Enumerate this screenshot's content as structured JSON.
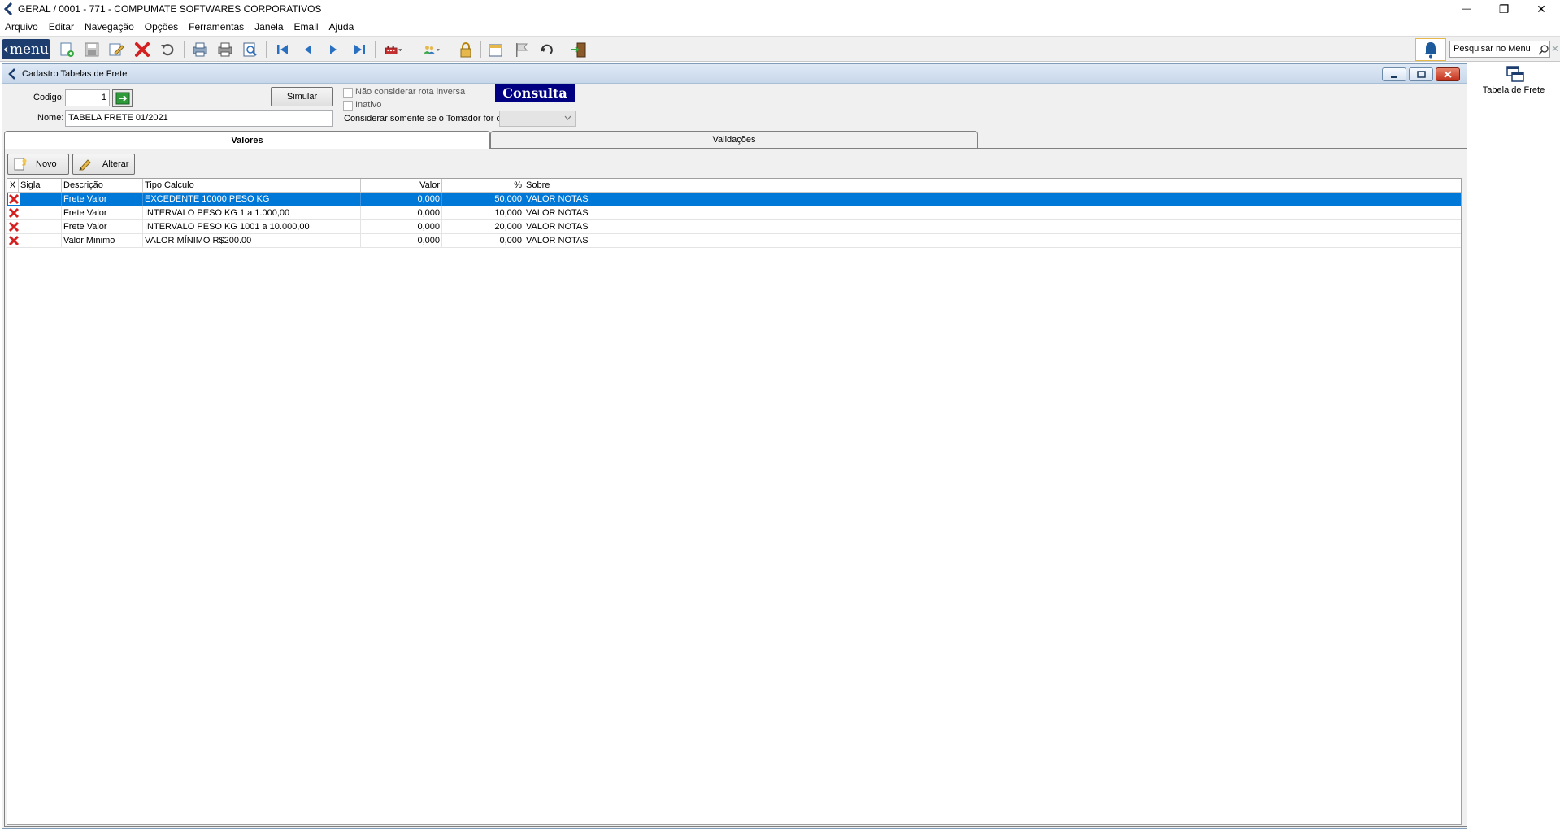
{
  "window": {
    "title": "GERAL / 0001 - 771 - COMPUMATE SOFTWARES CORPORATIVOS",
    "minimize_glyph": "—",
    "restore_glyph": "❐",
    "close_glyph": "✕"
  },
  "menubar": {
    "items": [
      "Arquivo",
      "Editar",
      "Navegação",
      "Opções",
      "Ferramentas",
      "Janela",
      "Email",
      "Ajuda"
    ]
  },
  "toolbar": {
    "menu_label": "menu",
    "search_placeholder": "Pesquisar no Menu",
    "icons": [
      "new-record-icon",
      "save-icon",
      "edit-icon",
      "delete-icon",
      "undo-icon",
      "print-preview-icon",
      "print-icon",
      "zoom-preview-icon",
      "first-record-icon",
      "previous-record-icon",
      "next-record-icon",
      "last-record-icon",
      "company-icon",
      "users-icon",
      "lock-icon",
      "notes-icon",
      "flag-icon",
      "refresh-icon",
      "exit-icon",
      "bell-icon"
    ]
  },
  "inner_window": {
    "title": "Cadastro Tabelas de Frete"
  },
  "form": {
    "codigo_label": "Codigo:",
    "codigo_value": "1",
    "nome_label": "Nome:",
    "nome_value": "TABELA FRETE 01/2021",
    "simular_label": "Simular",
    "nao_considerar_label": "Não considerar rota inversa",
    "inativo_label": "Inativo",
    "consulta_label": "Consulta",
    "tomador_label": "Considerar somente se o Tomador for o:"
  },
  "tabs": [
    {
      "label": "Valores",
      "active": true
    },
    {
      "label": "Validações",
      "active": false
    }
  ],
  "actions": {
    "novo_label": "Novo",
    "alterar_label": "Alterar"
  },
  "grid": {
    "columns": [
      "X",
      "Sigla",
      "Descrição",
      "Tipo Calculo",
      "Valor",
      "%",
      "Sobre"
    ],
    "rows": [
      {
        "sigla": "",
        "descricao": "Frete Valor",
        "tipo": "EXCEDENTE 10000 PESO KG",
        "valor": "0,000",
        "pct": "50,000",
        "sobre": "VALOR NOTAS",
        "selected": true
      },
      {
        "sigla": "",
        "descricao": "Frete Valor",
        "tipo": "INTERVALO PESO KG 1 a 1.000,00",
        "valor": "0,000",
        "pct": "10,000",
        "sobre": "VALOR NOTAS",
        "selected": false
      },
      {
        "sigla": "",
        "descricao": "Frete Valor",
        "tipo": "INTERVALO PESO KG 1001 a 10.000,00",
        "valor": "0,000",
        "pct": "20,000",
        "sobre": "VALOR NOTAS",
        "selected": false
      },
      {
        "sigla": "",
        "descricao": "Valor Minimo",
        "tipo": "VALOR MÍNIMO R$200.00",
        "valor": "0,000",
        "pct": "0,000",
        "sobre": "VALOR NOTAS",
        "selected": false
      }
    ]
  },
  "side_panel": {
    "shortcut_label": "Tabela de Frete"
  },
  "colors": {
    "selection": "#0078d7",
    "menu_button": "#1c3d6e",
    "consulta_bg": "#000080"
  }
}
